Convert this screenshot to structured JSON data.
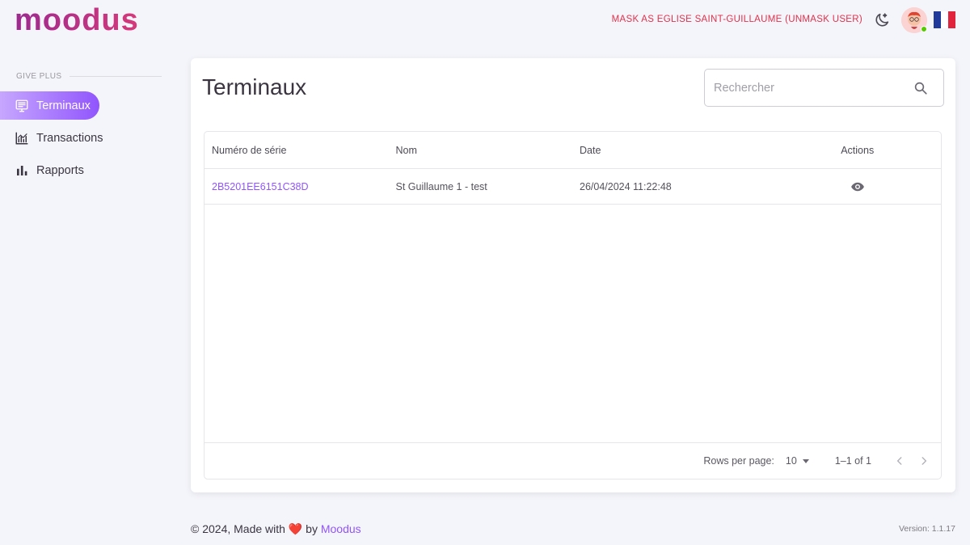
{
  "brand": {
    "logo_text": "moodus",
    "logo_colors": [
      "#9c2a8f",
      "#d63a7a"
    ]
  },
  "header": {
    "mask_text": "MASK AS EGLISE SAINT-GUILLAUME (UNMASK USER)",
    "theme_icon": "moon-icon",
    "flag": {
      "name": "france-flag",
      "colors": [
        "#1f3a9b",
        "#ffffff",
        "#e1243b"
      ]
    }
  },
  "sidebar": {
    "section": "GIVE PLUS",
    "items": [
      {
        "label": "Terminaux",
        "icon": "terminal-icon",
        "active": true
      },
      {
        "label": "Transactions",
        "icon": "chart-line-icon",
        "active": false
      },
      {
        "label": "Rapports",
        "icon": "bar-chart-icon",
        "active": false
      }
    ]
  },
  "main": {
    "title": "Terminaux",
    "search": {
      "placeholder": "Rechercher",
      "value": ""
    },
    "table": {
      "columns": [
        "Numéro de série",
        "Nom",
        "Date",
        "Actions"
      ],
      "rows": [
        {
          "serial": "2B5201EE6151C38D",
          "name": "St Guillaume 1 - test",
          "date": "26/04/2024 11:22:48",
          "action_icon": "eye-icon"
        }
      ]
    },
    "pagination": {
      "rows_per_page_label": "Rows per page:",
      "rows_per_page": "10",
      "range": "1–1 of 1"
    }
  },
  "footer": {
    "prefix": "© 2024, Made with",
    "heart": "❤️",
    "by": "by",
    "brand": "Moodus",
    "version": "Version: 1.1.17"
  },
  "colors": {
    "accent": "#9155fd",
    "danger": "#e0314b",
    "background": "#f4f5fa"
  }
}
